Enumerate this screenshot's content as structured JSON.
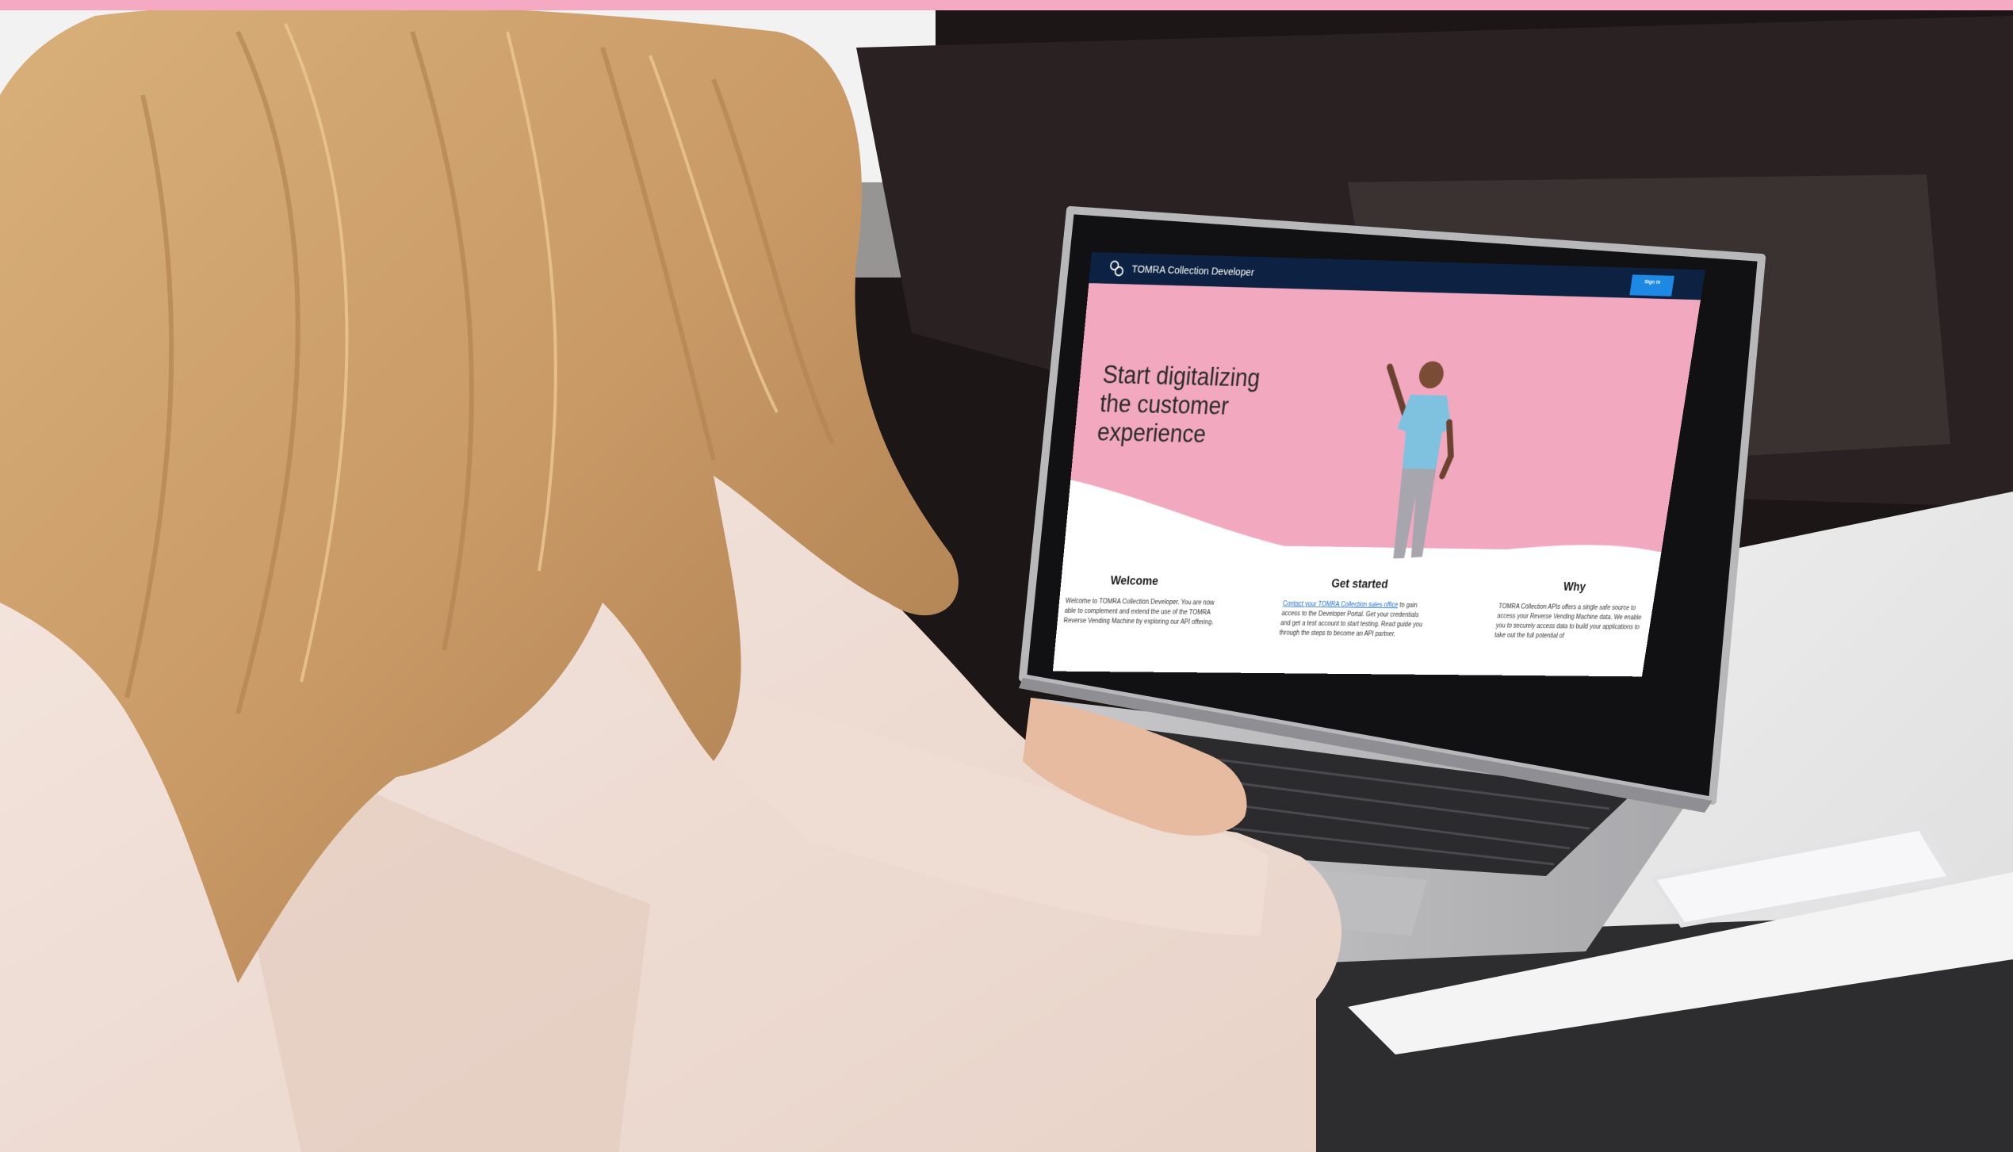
{
  "image": {
    "description_colors": {
      "top_bar": "#f6a9c2",
      "screen_header": "#0d2242",
      "screen_hero": "#f2a9c0",
      "screen_button": "#1e88e5"
    }
  },
  "laptop_screen": {
    "brand": "TOMRA Collection Developer",
    "signin_label": "Sign in",
    "hero_title": "Start digitalizing the customer experience",
    "columns": [
      {
        "title": "Welcome",
        "text": "Welcome to TOMRA Collection Developer. You are now able to complement and extend the use of the TOMRA Reverse Vending Machine by exploring our API offering."
      },
      {
        "title": "Get started",
        "link": "Contact your TOMRA Collection sales office",
        "text": "to gain access to the Developer Portal. Get your credentials and get a test account to start testing. Read guide you through the steps to become an API partner."
      },
      {
        "title": "Why",
        "text": "TOMRA Collection APIs offers a single safe source to access your Reverse Vending Machine data. We enable you to securely access data to build your applications to take out the full potential of"
      }
    ]
  }
}
